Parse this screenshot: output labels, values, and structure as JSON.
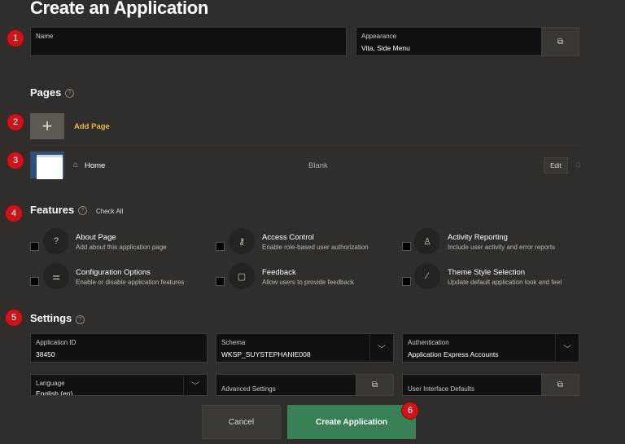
{
  "title": "Create an Application",
  "badges": [
    "1",
    "2",
    "3",
    "4",
    "5",
    "6"
  ],
  "name_field": {
    "label": "Name",
    "value": ""
  },
  "appearance": {
    "label": "Appearance",
    "value": "Vita, Side Menu",
    "icon": "popup-icon"
  },
  "pages": {
    "heading": "Pages",
    "add_label": "Add Page",
    "rows": [
      {
        "name": "Home",
        "type": "Blank",
        "edit_label": "Edit"
      }
    ]
  },
  "features": {
    "heading": "Features",
    "check_all": "Check All",
    "items": [
      {
        "title": "About Page",
        "desc": "Add about this application page",
        "icon": "question-icon"
      },
      {
        "title": "Access Control",
        "desc": "Enable role-based user authorization",
        "icon": "key-icon"
      },
      {
        "title": "Activity Reporting",
        "desc": "Include user activity and error reports",
        "icon": "user-report-icon"
      },
      {
        "title": "Configuration Options",
        "desc": "Enable or disable application features",
        "icon": "sliders-icon"
      },
      {
        "title": "Feedback",
        "desc": "Allow users to provide feedback",
        "icon": "comment-icon"
      },
      {
        "title": "Theme Style Selection",
        "desc": "Update default application look and feel",
        "icon": "brush-icon"
      }
    ]
  },
  "settings": {
    "heading": "Settings",
    "app_id": {
      "label": "Application ID",
      "value": "38450"
    },
    "schema": {
      "label": "Schema",
      "value": "WKSP_SUYSTEPHANIE008"
    },
    "auth": {
      "label": "Authentication",
      "value": "Application Express Accounts"
    },
    "language": {
      "label": "Language",
      "value": "English (en)"
    },
    "advanced": {
      "label": "Advanced Settings"
    },
    "ui_defaults": {
      "label": "User Interface Defaults"
    }
  },
  "footer": {
    "cancel": "Cancel",
    "create": "Create Application"
  },
  "colors": {
    "accent_yellow": "#e8b84a",
    "create_green": "#3a8056",
    "badge_red": "#c8161d"
  }
}
